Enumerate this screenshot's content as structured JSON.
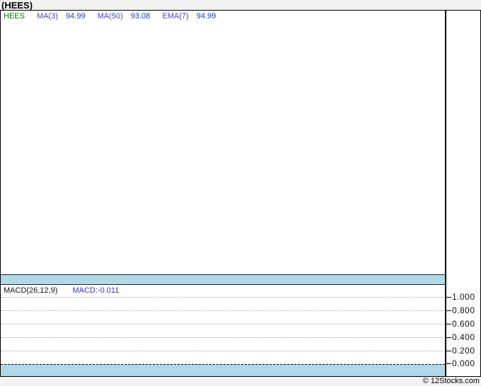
{
  "title": "(HEES)",
  "price_pane": {
    "legend": {
      "symbol": "HEES",
      "items": [
        {
          "label": "MA(3)",
          "value": "94.99"
        },
        {
          "label": "MA(50)",
          "value": "93.08"
        },
        {
          "label": "EMA(7)",
          "value": "94.99"
        }
      ]
    }
  },
  "macd_pane": {
    "legend_label": "MACD(26,12,9)",
    "legend_value": "MACD:-0.011",
    "axis_ticks": [
      "1.000",
      "0.800",
      "0.600",
      "0.400",
      "0.200",
      "0.000"
    ]
  },
  "footer": {
    "copyright": "© 12Stocks.com"
  },
  "colors": {
    "background": "#f2f2f2",
    "pane_background": "#ffffff",
    "separator_bar": "#b0d9e8",
    "border": "#000000",
    "symbol_green": "#007700",
    "indicator_label_purple": "#4444cc",
    "indicator_value_blue": "#2233cc",
    "macd_value_blue": "#3333cc",
    "gridline_gray": "#aaaaaa"
  },
  "chart_data": [
    {
      "type": "line",
      "pane": "price",
      "title": "(HEES)",
      "series": [
        {
          "name": "HEES",
          "color": "#007700",
          "values": []
        },
        {
          "name": "MA(3)",
          "last_value": 94.99
        },
        {
          "name": "MA(50)",
          "last_value": 93.08
        },
        {
          "name": "EMA(7)",
          "last_value": 94.99
        }
      ],
      "note": "price plot area is rendered empty (no candles/lines visible)",
      "grid": false
    },
    {
      "type": "line",
      "pane": "MACD",
      "title": "MACD(26,12,9)",
      "series": [
        {
          "name": "MACD",
          "last_value": -0.011,
          "values": []
        }
      ],
      "ylim": [
        0.0,
        1.0
      ],
      "yticks": [
        1.0,
        0.8,
        0.6,
        0.4,
        0.2,
        0.0
      ],
      "grid": true,
      "legend_position": "top-left",
      "axis_position": "right",
      "note": "MACD plot area is rendered empty; only dotted gridlines and dashed zero line visible"
    }
  ]
}
